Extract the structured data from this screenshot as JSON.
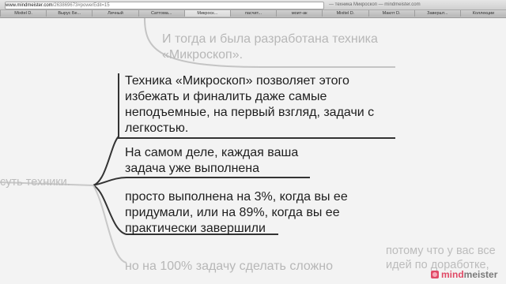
{
  "browser": {
    "url_domain": "www.mindmeister.com",
    "url_rest": "/263869673#powerEdit=15",
    "page_title": "— техника Микроскоп — mindmeister.com",
    "tabs": [
      "Mixitel D.",
      "Вырус Бе...",
      "Личный",
      "Саттома...",
      "Микроск...",
      "пасчит...",
      "моит-ак",
      "Mixitel D.",
      "Маклт D.",
      "Завершт...",
      "Коллекции"
    ]
  },
  "mindmap": {
    "top_node": "И тогда и была разработана техника «Микроскоп».",
    "central_node": "суть техники.",
    "nodes": [
      "Техника «Микроскоп» позволяет этого избежать и финалить даже самые неподъемные, на первый взгляд, задачи с легкостью.",
      "На самом деле, каждая ваша задача уже выполнена",
      "просто выполнена на 3%, когда вы ее придумали, или на 89%, когда вы ее практически завершили",
      "но на 100% задачу сделать сложно"
    ],
    "side_node": "потому что у вас все идей по доработке, усовершенствованию"
  },
  "logo": {
    "mind": "mind",
    "meister": "meister"
  }
}
